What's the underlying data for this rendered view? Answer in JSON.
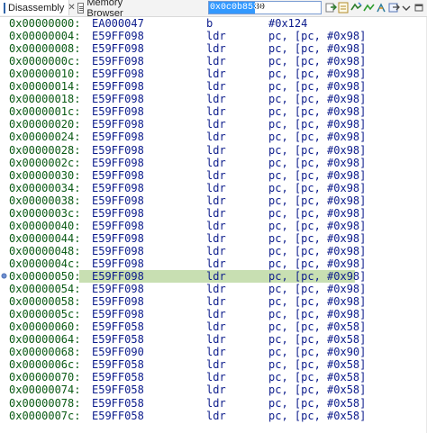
{
  "tabs": [
    {
      "label": "Disassembly",
      "close": "✕"
    },
    {
      "label": "Memory Browser"
    }
  ],
  "address_input": {
    "value": "0x0c0b8530"
  },
  "toolbar": [
    {
      "icon": "go-to-address-icon"
    },
    {
      "icon": "link-with-pc-icon"
    },
    {
      "icon": "show-source-icon"
    },
    {
      "icon": "copy-icon"
    },
    {
      "icon": "save-icon"
    },
    {
      "icon": "step-into-icon"
    },
    {
      "icon": "step-over-icon"
    },
    {
      "icon": "step-return-icon"
    },
    {
      "icon": "menu-icon"
    }
  ],
  "colors": {
    "address": "#0a5a14",
    "code": "#0c1c8c",
    "highlight": "#c8dfb2"
  },
  "current_row_index": 20,
  "rows": [
    {
      "addr": "0x00000000:",
      "hex": "EA000047",
      "mn": "b",
      "op": "#0x124"
    },
    {
      "addr": "0x00000004:",
      "hex": "E59FF098",
      "mn": "ldr",
      "op": "pc, [pc, #0x98]"
    },
    {
      "addr": "0x00000008:",
      "hex": "E59FF098",
      "mn": "ldr",
      "op": "pc, [pc, #0x98]"
    },
    {
      "addr": "0x0000000c:",
      "hex": "E59FF098",
      "mn": "ldr",
      "op": "pc, [pc, #0x98]"
    },
    {
      "addr": "0x00000010:",
      "hex": "E59FF098",
      "mn": "ldr",
      "op": "pc, [pc, #0x98]"
    },
    {
      "addr": "0x00000014:",
      "hex": "E59FF098",
      "mn": "ldr",
      "op": "pc, [pc, #0x98]"
    },
    {
      "addr": "0x00000018:",
      "hex": "E59FF098",
      "mn": "ldr",
      "op": "pc, [pc, #0x98]"
    },
    {
      "addr": "0x0000001c:",
      "hex": "E59FF098",
      "mn": "ldr",
      "op": "pc, [pc, #0x98]"
    },
    {
      "addr": "0x00000020:",
      "hex": "E59FF098",
      "mn": "ldr",
      "op": "pc, [pc, #0x98]"
    },
    {
      "addr": "0x00000024:",
      "hex": "E59FF098",
      "mn": "ldr",
      "op": "pc, [pc, #0x98]"
    },
    {
      "addr": "0x00000028:",
      "hex": "E59FF098",
      "mn": "ldr",
      "op": "pc, [pc, #0x98]"
    },
    {
      "addr": "0x0000002c:",
      "hex": "E59FF098",
      "mn": "ldr",
      "op": "pc, [pc, #0x98]"
    },
    {
      "addr": "0x00000030:",
      "hex": "E59FF098",
      "mn": "ldr",
      "op": "pc, [pc, #0x98]"
    },
    {
      "addr": "0x00000034:",
      "hex": "E59FF098",
      "mn": "ldr",
      "op": "pc, [pc, #0x98]"
    },
    {
      "addr": "0x00000038:",
      "hex": "E59FF098",
      "mn": "ldr",
      "op": "pc, [pc, #0x98]"
    },
    {
      "addr": "0x0000003c:",
      "hex": "E59FF098",
      "mn": "ldr",
      "op": "pc, [pc, #0x98]"
    },
    {
      "addr": "0x00000040:",
      "hex": "E59FF098",
      "mn": "ldr",
      "op": "pc, [pc, #0x98]"
    },
    {
      "addr": "0x00000044:",
      "hex": "E59FF098",
      "mn": "ldr",
      "op": "pc, [pc, #0x98]"
    },
    {
      "addr": "0x00000048:",
      "hex": "E59FF098",
      "mn": "ldr",
      "op": "pc, [pc, #0x98]"
    },
    {
      "addr": "0x0000004c:",
      "hex": "E59FF098",
      "mn": "ldr",
      "op": "pc, [pc, #0x98]"
    },
    {
      "addr": "0x00000050:",
      "hex": "E59FF098",
      "mn": "ldr",
      "op": "pc, [pc, #0x98]"
    },
    {
      "addr": "0x00000054:",
      "hex": "E59FF098",
      "mn": "ldr",
      "op": "pc, [pc, #0x98]"
    },
    {
      "addr": "0x00000058:",
      "hex": "E59FF098",
      "mn": "ldr",
      "op": "pc, [pc, #0x98]"
    },
    {
      "addr": "0x0000005c:",
      "hex": "E59FF098",
      "mn": "ldr",
      "op": "pc, [pc, #0x98]"
    },
    {
      "addr": "0x00000060:",
      "hex": "E59FF058",
      "mn": "ldr",
      "op": "pc, [pc, #0x58]"
    },
    {
      "addr": "0x00000064:",
      "hex": "E59FF058",
      "mn": "ldr",
      "op": "pc, [pc, #0x58]"
    },
    {
      "addr": "0x00000068:",
      "hex": "E59FF090",
      "mn": "ldr",
      "op": "pc, [pc, #0x90]"
    },
    {
      "addr": "0x0000006c:",
      "hex": "E59FF058",
      "mn": "ldr",
      "op": "pc, [pc, #0x58]"
    },
    {
      "addr": "0x00000070:",
      "hex": "E59FF058",
      "mn": "ldr",
      "op": "pc, [pc, #0x58]"
    },
    {
      "addr": "0x00000074:",
      "hex": "E59FF058",
      "mn": "ldr",
      "op": "pc, [pc, #0x58]"
    },
    {
      "addr": "0x00000078:",
      "hex": "E59FF058",
      "mn": "ldr",
      "op": "pc, [pc, #0x58]"
    },
    {
      "addr": "0x0000007c:",
      "hex": "E59FF058",
      "mn": "ldr",
      "op": "pc, [pc, #0x58]"
    }
  ]
}
